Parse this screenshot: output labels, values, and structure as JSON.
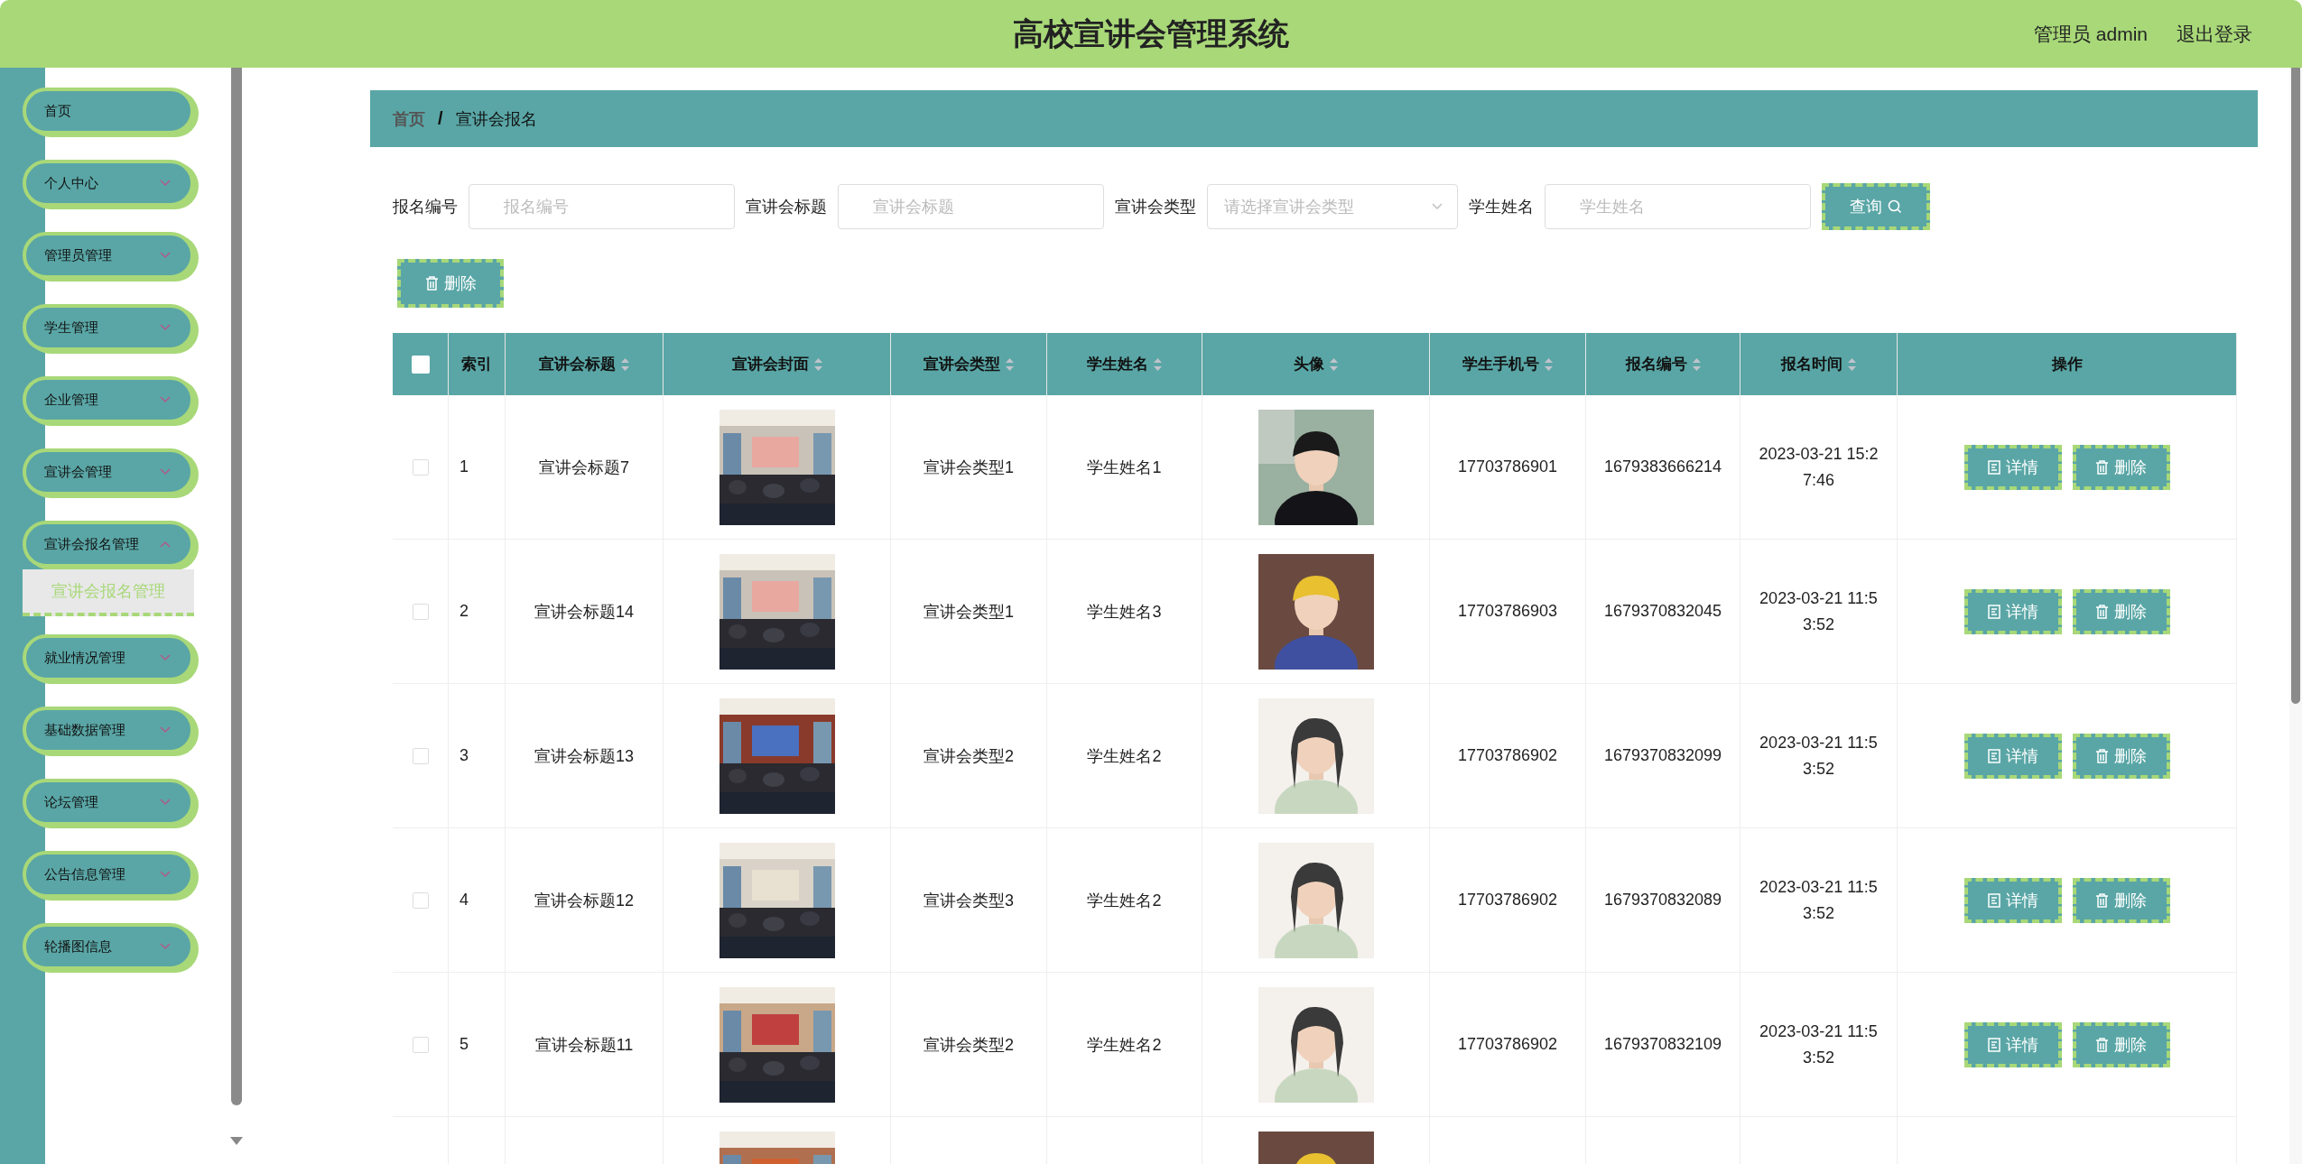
{
  "header": {
    "title": "高校宣讲会管理系统",
    "user": "管理员 admin",
    "logout": "退出登录"
  },
  "sidebar": {
    "items": [
      {
        "label": "首页",
        "expandable": false
      },
      {
        "label": "个人中心",
        "expandable": true,
        "expanded": false
      },
      {
        "label": "管理员管理",
        "expandable": true,
        "expanded": false
      },
      {
        "label": "学生管理",
        "expandable": true,
        "expanded": false
      },
      {
        "label": "企业管理",
        "expandable": true,
        "expanded": false
      },
      {
        "label": "宣讲会管理",
        "expandable": true,
        "expanded": false
      },
      {
        "label": "宣讲会报名管理",
        "expandable": true,
        "expanded": true,
        "children": [
          {
            "label": "宣讲会报名管理",
            "selected": true
          }
        ]
      },
      {
        "label": "就业情况管理",
        "expandable": true,
        "expanded": false
      },
      {
        "label": "基础数据管理",
        "expandable": true,
        "expanded": false
      },
      {
        "label": "论坛管理",
        "expandable": true,
        "expanded": false
      },
      {
        "label": "公告信息管理",
        "expandable": true,
        "expanded": false
      },
      {
        "label": "轮播图信息",
        "expandable": true,
        "expanded": false
      }
    ]
  },
  "breadcrumb": [
    {
      "label": "首页",
      "current": false
    },
    {
      "label": "宣讲会报名",
      "current": true
    }
  ],
  "breadcrumb_separator": "/",
  "filters": [
    {
      "label": "报名编号",
      "placeholder": "报名编号",
      "kind": "input"
    },
    {
      "label": "宣讲会标题",
      "placeholder": "宣讲会标题",
      "kind": "input"
    },
    {
      "label": "宣讲会类型",
      "placeholder": "请选择宣讲会类型",
      "kind": "select"
    },
    {
      "label": "学生姓名",
      "placeholder": "学生姓名",
      "kind": "input"
    }
  ],
  "search_button": "查询",
  "delete_button": "删除",
  "table": {
    "select_all": false,
    "columns": [
      {
        "label": "索引",
        "sortable": false
      },
      {
        "label": "宣讲会标题",
        "sortable": true
      },
      {
        "label": "宣讲会封面",
        "sortable": true
      },
      {
        "label": "宣讲会类型",
        "sortable": true
      },
      {
        "label": "学生姓名",
        "sortable": true
      },
      {
        "label": "头像",
        "sortable": true
      },
      {
        "label": "学生手机号",
        "sortable": true
      },
      {
        "label": "报名编号",
        "sortable": true
      },
      {
        "label": "报名时间",
        "sortable": true
      },
      {
        "label": "操作",
        "sortable": false
      }
    ],
    "rows": [
      {
        "selected": false,
        "index": "1",
        "title": "宣讲会标题7",
        "type": "宣讲会类型1",
        "student": "学生姓名1",
        "phone": "17703786901",
        "number": "1679383666214",
        "time": "2023-03-21 15:27:46",
        "detail_button": "详情",
        "delete_button": "删除"
      },
      {
        "selected": false,
        "index": "2",
        "title": "宣讲会标题14",
        "type": "宣讲会类型1",
        "student": "学生姓名3",
        "phone": "17703786903",
        "number": "1679370832045",
        "time": "2023-03-21 11:53:52",
        "detail_button": "详情",
        "delete_button": "删除"
      },
      {
        "selected": false,
        "index": "3",
        "title": "宣讲会标题13",
        "type": "宣讲会类型2",
        "student": "学生姓名2",
        "phone": "17703786902",
        "number": "1679370832099",
        "time": "2023-03-21 11:53:52",
        "detail_button": "详情",
        "delete_button": "删除"
      },
      {
        "selected": false,
        "index": "4",
        "title": "宣讲会标题12",
        "type": "宣讲会类型3",
        "student": "学生姓名2",
        "phone": "17703786902",
        "number": "1679370832089",
        "time": "2023-03-21 11:53:52",
        "detail_button": "详情",
        "delete_button": "删除"
      },
      {
        "selected": false,
        "index": "5",
        "title": "宣讲会标题11",
        "type": "宣讲会类型2",
        "student": "学生姓名2",
        "phone": "17703786902",
        "number": "1679370832109",
        "time": "2023-03-21 11:53:52",
        "detail_button": "详情",
        "delete_button": "删除"
      }
    ],
    "more_rows_below": true
  }
}
